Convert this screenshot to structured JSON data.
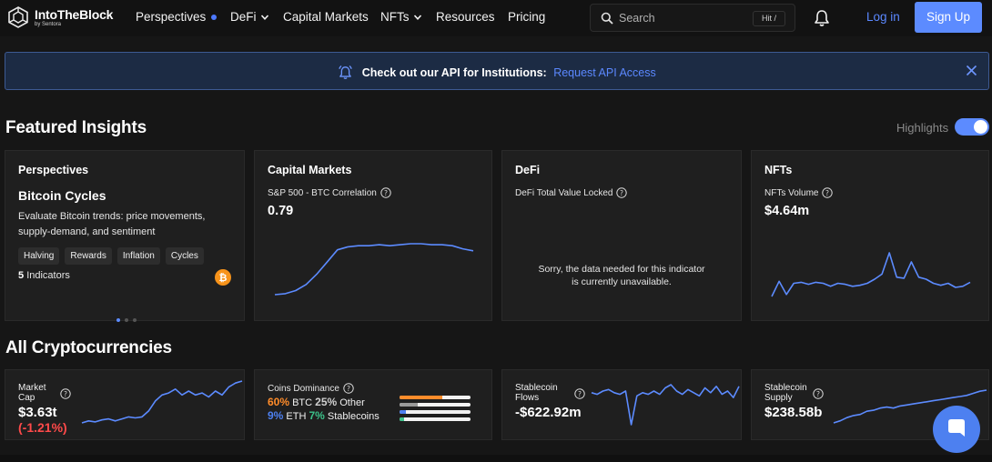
{
  "nav": {
    "logo_name": "IntoTheBlock",
    "logo_sub": "by Sentora",
    "items": [
      {
        "label": "Perspectives"
      },
      {
        "label": "DeFi"
      },
      {
        "label": "Capital Markets"
      },
      {
        "label": "NFTs"
      },
      {
        "label": "Resources"
      },
      {
        "label": "Pricing"
      }
    ],
    "search_placeholder": "Search",
    "search_hint": "Hit /",
    "login": "Log in",
    "signup": "Sign Up"
  },
  "banner": {
    "text": "Check out our API for Institutions:",
    "link": "Request API Access"
  },
  "featured": {
    "title": "Featured Insights",
    "highlights_label": "Highlights",
    "highlights_on": true,
    "cards": [
      {
        "title": "Perspectives",
        "heading": "Bitcoin Cycles",
        "description": "Evaluate Bitcoin trends: price movements, supply-demand, and sentiment",
        "tags": [
          "Halving",
          "Rewards",
          "Inflation",
          "Cycles"
        ],
        "indicators_count": "5",
        "indicators_label": "Indicators"
      },
      {
        "title": "Capital Markets",
        "metric": "S&P 500 - BTC Correlation",
        "value": "0.79",
        "series": [
          0.3,
          0.31,
          0.34,
          0.4,
          0.5,
          0.62,
          0.74,
          0.77,
          0.78,
          0.78,
          0.79,
          0.78,
          0.79,
          0.8,
          0.8,
          0.79,
          0.79,
          0.78,
          0.75,
          0.73
        ]
      },
      {
        "title": "DeFi",
        "metric": "DeFi Total Value Locked",
        "unavailable_line1": "Sorry, the data needed for this indicator",
        "unavailable_line2": "is currently unavailable."
      },
      {
        "title": "NFTs",
        "metric": "NFTs Volume",
        "value": "$4.64m",
        "series": [
          2.0,
          3.5,
          2.2,
          3.3,
          3.4,
          3.2,
          3.4,
          3.3,
          3.0,
          3.3,
          3.2,
          3.0,
          3.1,
          3.3,
          3.7,
          4.2,
          6.3,
          3.9,
          3.8,
          5.4,
          3.9,
          3.7,
          3.3,
          3.1,
          3.3,
          2.9,
          3.0,
          3.4
        ]
      }
    ]
  },
  "crypto": {
    "title": "All Cryptocurrencies",
    "market_cap": {
      "label": "Market Cap",
      "value": "$3.63t",
      "change": "(-1.21%)",
      "series": [
        1.0,
        1.1,
        1.05,
        1.15,
        1.2,
        1.1,
        1.2,
        1.3,
        1.25,
        1.3,
        1.6,
        2.1,
        2.4,
        2.5,
        2.7,
        2.4,
        2.6,
        2.4,
        2.5,
        2.3,
        2.6,
        2.4,
        2.8,
        3.0,
        3.1
      ]
    },
    "dominance": {
      "label": "Coins Dominance",
      "rows": [
        [
          {
            "pct": "60%",
            "name": "BTC",
            "color": "#ff8c2a"
          },
          {
            "pct": "25%",
            "name": "Other",
            "color": "#cfcfcf"
          }
        ],
        [
          {
            "pct": "9%",
            "name": "ETH",
            "color": "#4d80f0"
          },
          {
            "pct": "7%",
            "name": "Stablecoins",
            "color": "#3cc28a"
          }
        ]
      ],
      "bars": [
        {
          "fraction": 0.6,
          "color": "#ff8c2a"
        },
        {
          "fraction": 0.25,
          "color": "#9a9a9a"
        },
        {
          "fraction": 0.09,
          "color": "#4d80f0"
        },
        {
          "fraction": 0.07,
          "color": "#3cc28a"
        }
      ]
    },
    "stable_flows": {
      "label": "Stablecoin Flows",
      "value": "-$622.92m",
      "series": [
        2.5,
        2.4,
        2.6,
        2.7,
        2.5,
        2.4,
        2.6,
        0.5,
        2.3,
        2.5,
        2.4,
        2.6,
        2.4,
        2.8,
        3.0,
        2.6,
        2.4,
        2.7,
        2.5,
        2.3,
        2.8,
        2.5,
        2.9,
        2.4,
        2.6,
        2.2,
        2.9
      ]
    },
    "stable_supply": {
      "label": "Stablecoin Supply",
      "value": "$238.58b",
      "series": [
        0.2,
        0.4,
        0.7,
        0.9,
        1.0,
        1.3,
        1.4,
        1.6,
        1.7,
        1.6,
        1.8,
        1.9,
        2.0,
        2.1,
        2.2,
        2.3,
        2.4,
        2.5,
        2.6,
        2.7,
        2.8,
        3.0,
        3.2,
        3.3
      ]
    }
  },
  "colors": {
    "accent": "#5c8bff",
    "line": "#5c8bff",
    "negative": "#ff4a4a",
    "card_bg": "#1f1f1f"
  }
}
